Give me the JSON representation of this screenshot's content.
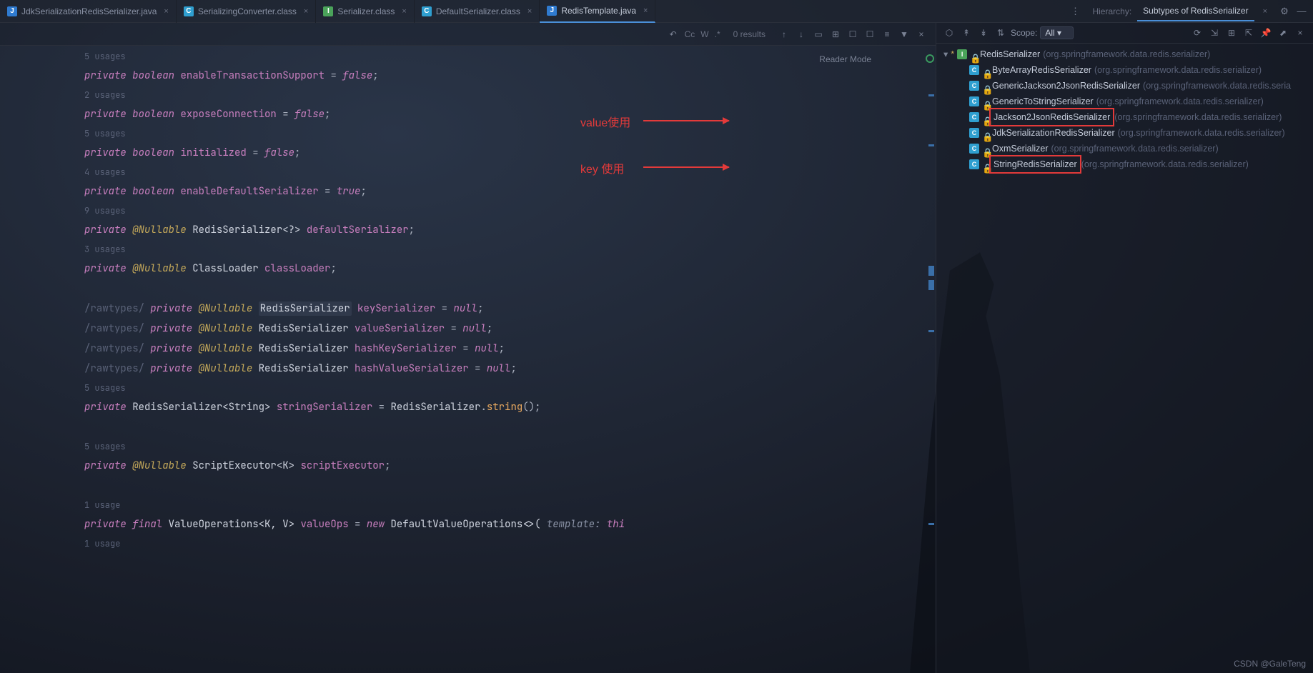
{
  "tabs": [
    {
      "icon": "j",
      "label": "JdkSerializationRedisSerializer.java"
    },
    {
      "icon": "c",
      "label": "SerializingConverter.class"
    },
    {
      "icon": "i",
      "label": "Serializer.class"
    },
    {
      "icon": "c",
      "label": "DefaultSerializer.class"
    },
    {
      "icon": "j",
      "label": "RedisTemplate.java",
      "active": true
    }
  ],
  "hierarchy_header": {
    "prefix": "Hierarchy:",
    "title": "Subtypes of RedisSerializer"
  },
  "toolbar": {
    "results": "0 results",
    "cc": "Cc",
    "w": "W",
    "regex": ".*"
  },
  "reader": "Reader Mode",
  "gutter": [
    "",
    "",
    "",
    "",
    "",
    "",
    "",
    "",
    "",
    ""
  ],
  "code": {
    "u1": "5 usages",
    "l1": {
      "kw": "private",
      "kw2": "boolean",
      "name": "enableTransactionSupport",
      "eq": " = ",
      "val": "false",
      "sc": ";"
    },
    "u2": "2 usages",
    "l2": {
      "kw": "private",
      "kw2": "boolean",
      "name": "exposeConnection",
      "eq": " = ",
      "val": "false",
      "sc": ";"
    },
    "u3": "5 usages",
    "l3": {
      "kw": "private",
      "kw2": "boolean",
      "name": "initialized",
      "eq": " = ",
      "val": "false",
      "sc": ";"
    },
    "u4": "4 usages",
    "l4": {
      "kw": "private",
      "kw2": "boolean",
      "name": "enableDefaultSerializer",
      "eq": " = ",
      "val": "true",
      "sc": ";"
    },
    "u5": "9 usages",
    "l5": {
      "kw": "private",
      "ann": "@Nullable",
      "type": "RedisSerializer<?>",
      "name": "defaultSerializer",
      "sc": ";"
    },
    "u6": "3 usages",
    "l6": {
      "kw": "private",
      "ann": "@Nullable",
      "type": "ClassLoader",
      "name": "classLoader",
      "sc": ";"
    },
    "l7": {
      "cmt": "/rawtypes/",
      "kw": "private",
      "ann": "@Nullable",
      "type": "RedisSerializer",
      "name": "keySerializer",
      "eq": " = ",
      "val": "null",
      "sc": ";"
    },
    "l8": {
      "cmt": "/rawtypes/",
      "kw": "private",
      "ann": "@Nullable",
      "type": "RedisSerializer",
      "name": "valueSerializer",
      "eq": " = ",
      "val": "null",
      "sc": ";"
    },
    "l9": {
      "cmt": "/rawtypes/",
      "kw": "private",
      "ann": "@Nullable",
      "type": "RedisSerializer",
      "name": "hashKeySerializer",
      "eq": " = ",
      "val": "null",
      "sc": ";"
    },
    "l10": {
      "cmt": "/rawtypes/",
      "kw": "private",
      "ann": "@Nullable",
      "type": "RedisSerializer",
      "name": "hashValueSerializer",
      "eq": " = ",
      "val": "null",
      "sc": ";"
    },
    "u7": "5 usages",
    "l11": {
      "kw": "private",
      "type": "RedisSerializer<String>",
      "name": "stringSerializer",
      "eq": " = ",
      "type2": "RedisSerializer",
      "dot": ".",
      "method": "string",
      "paren": "();"
    },
    "u8": "5 usages",
    "l12": {
      "kw": "private",
      "ann": "@Nullable",
      "type": "ScriptExecutor<K>",
      "name": "scriptExecutor",
      "sc": ";"
    },
    "u9": "1 usage",
    "l13": {
      "kw": "private",
      "kw2": "final",
      "type": "ValueOperations<K, V>",
      "name": "valueOps",
      "eq": " = ",
      "kw3": "new",
      "type2": "DefaultValueOperations<>(",
      "hint": "template:",
      "tail": "thi"
    },
    "u10": "1 usage"
  },
  "hierarchy": {
    "scope_label": "Scope:",
    "scope_value": "All",
    "root": {
      "name": "RedisSerializer",
      "pkg": "(org.springframework.data.redis.serializer)"
    },
    "children": [
      {
        "icon": "c",
        "name": "ByteArrayRedisSerializer",
        "pkg": "(org.springframework.data.redis.serializer)"
      },
      {
        "icon": "c",
        "name": "GenericJackson2JsonRedisSerializer",
        "pkg": "(org.springframework.data.redis.seria"
      },
      {
        "icon": "c",
        "name": "GenericToStringSerializer",
        "pkg": "(org.springframework.data.redis.serializer)"
      },
      {
        "icon": "c",
        "name": "Jackson2JsonRedisSerializer",
        "pkg": "(org.springframework.data.redis.serializer)",
        "box": true
      },
      {
        "icon": "c",
        "name": "JdkSerializationRedisSerializer",
        "pkg": "(org.springframework.data.redis.serializer)"
      },
      {
        "icon": "c",
        "name": "OxmSerializer",
        "pkg": "(org.springframework.data.redis.serializer)"
      },
      {
        "icon": "c",
        "name": "StringRedisSerializer",
        "pkg": "(org.springframework.data.redis.serializer)",
        "box": true
      }
    ]
  },
  "annotations": {
    "value": "value使用",
    "key": "key 使用"
  },
  "watermark": "CSDN @GaleTeng"
}
